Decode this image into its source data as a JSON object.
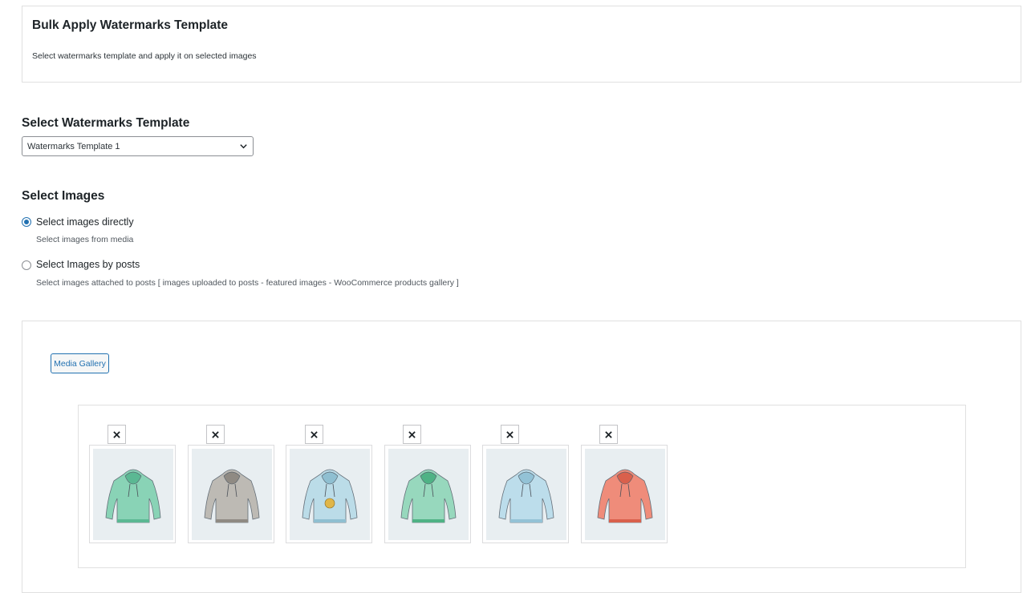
{
  "header": {
    "title": "Bulk Apply Watermarks Template",
    "description": "Select watermarks template and apply it on selected images"
  },
  "template_section": {
    "title": "Select Watermarks Template",
    "selected": "Watermarks Template 1",
    "chevron_icon": "chevron-down-icon"
  },
  "images_section": {
    "title": "Select Images",
    "options": [
      {
        "label": "Select images directly",
        "description": "Select images from media",
        "checked": true
      },
      {
        "label": "Select Images by posts",
        "description": "Select images attached to posts [ images uploaded to posts - featured images - WooCommerce products gallery ]",
        "checked": false
      }
    ]
  },
  "gallery": {
    "button_label": "Media Gallery",
    "remove_icon": "close-icon",
    "images": [
      {
        "name": "hoodie-green",
        "color": "#7fd1b0",
        "accent": "#5bb893"
      },
      {
        "name": "hoodie-gray",
        "color": "#b9b5ae",
        "accent": "#8f8a83"
      },
      {
        "name": "hoodie-light-blue-logo",
        "color": "#b7dbe8",
        "accent": "#8fbfd1"
      },
      {
        "name": "hoodie-mint",
        "color": "#8fd6b8",
        "accent": "#4fb285"
      },
      {
        "name": "hoodie-light-blue",
        "color": "#b8dceb",
        "accent": "#93c2d6"
      },
      {
        "name": "hoodie-coral",
        "color": "#f0826e",
        "accent": "#d9604c"
      }
    ]
  },
  "colors": {
    "accent": "#2271b1",
    "border": "#e0e0e0"
  }
}
